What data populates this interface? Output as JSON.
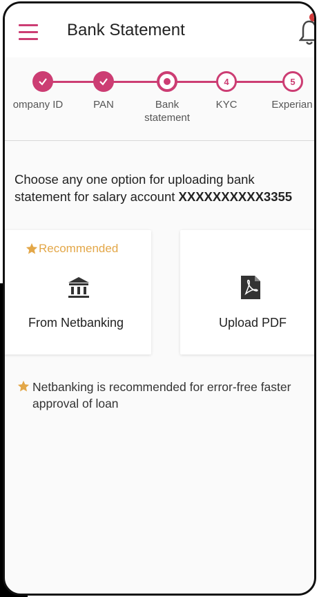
{
  "header": {
    "title": "Bank Statement",
    "menu_icon": "hamburger-menu-icon",
    "bell_icon": "notification-bell-icon"
  },
  "stepper": {
    "accent": "#cc3d73",
    "steps": [
      {
        "label": "ompany ID",
        "state": "done"
      },
      {
        "label": "PAN",
        "state": "done"
      },
      {
        "label": "Bank\nstatement",
        "state": "current"
      },
      {
        "label": "KYC",
        "state": "todo",
        "number": "4"
      },
      {
        "label": "Experian",
        "state": "todo",
        "number": "5"
      }
    ]
  },
  "main": {
    "instruction": "Choose any one option for uploading bank statement for salary account ",
    "account_number": "XXXXXXXXXX3355",
    "options": [
      {
        "badge": "Recommended",
        "label": "From Netbanking",
        "icon": "bank-icon"
      },
      {
        "label": "Upload PDF",
        "icon": "pdf-file-icon"
      }
    ],
    "note": "Netbanking is recommended for error-free faster approval of loan",
    "recommended_color": "#e3a748"
  }
}
